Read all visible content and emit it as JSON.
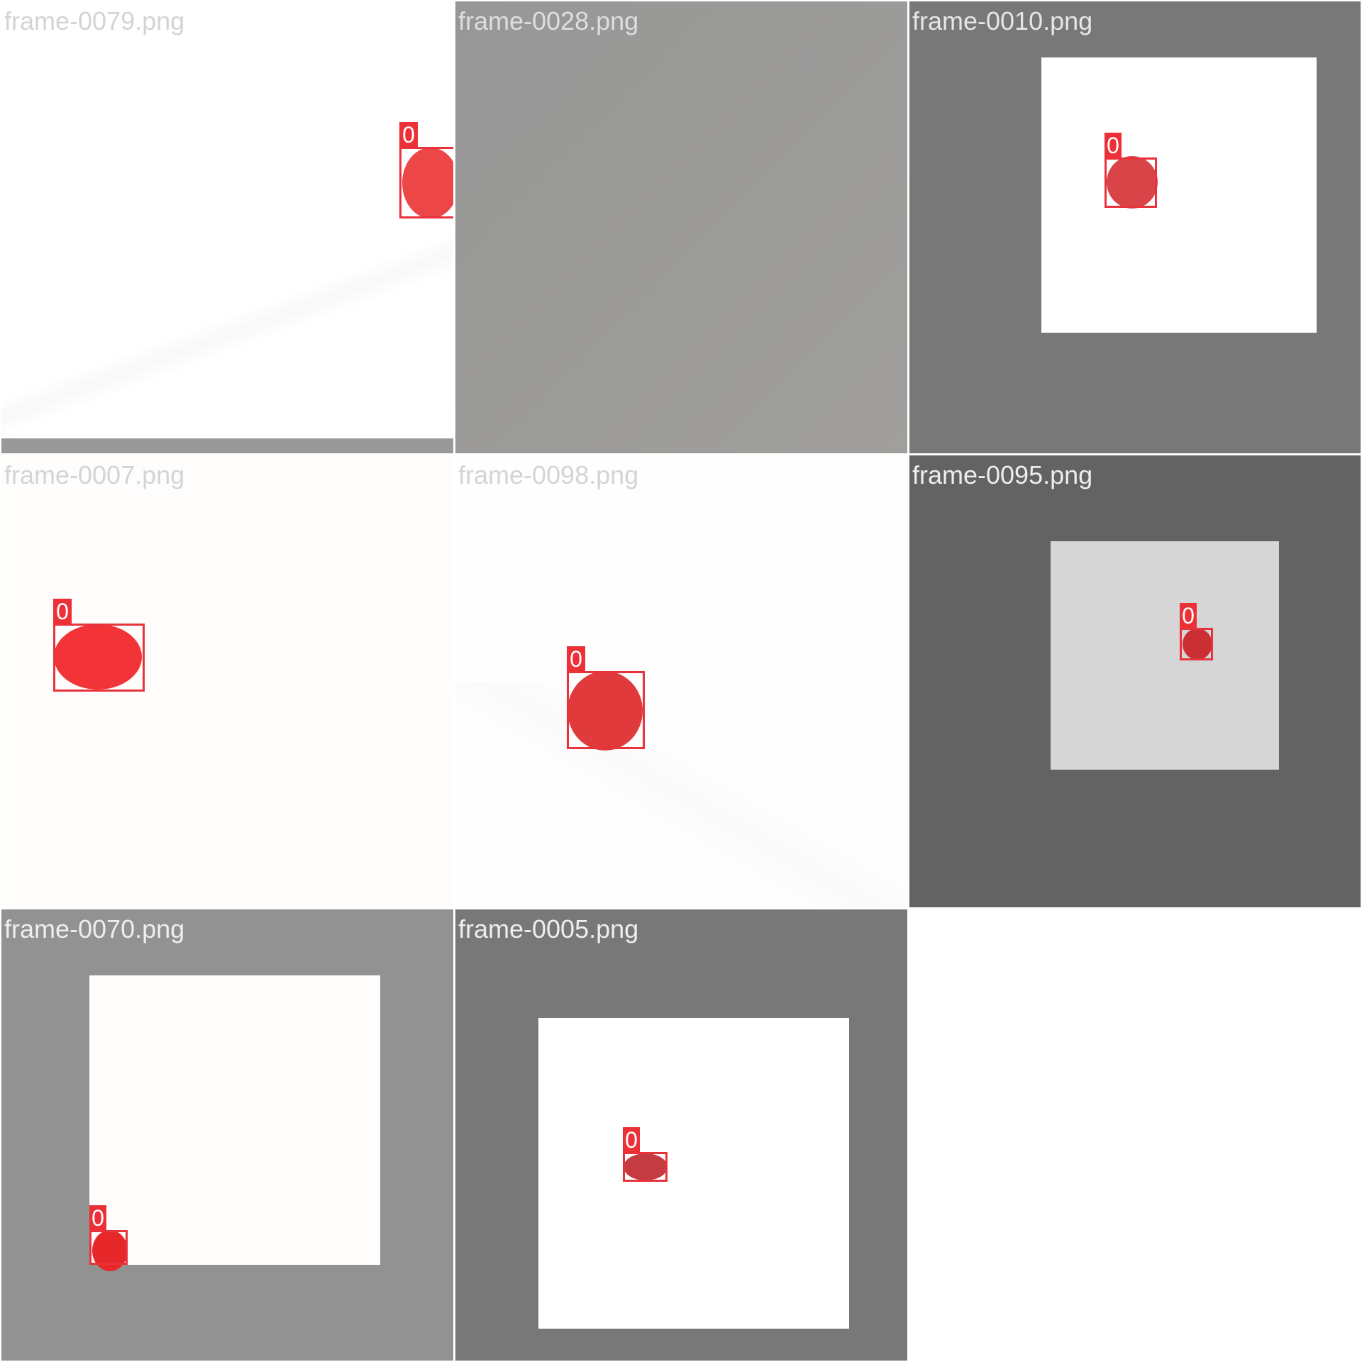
{
  "tiles": [
    {
      "filename": "frame-0079.png",
      "label": "0"
    },
    {
      "filename": "frame-0028.png"
    },
    {
      "filename": "frame-0010.png",
      "label": "0"
    },
    {
      "filename": "frame-0007.png",
      "label": "0"
    },
    {
      "filename": "frame-0098.png",
      "label": "0"
    },
    {
      "filename": "frame-0095.png",
      "label": "0"
    },
    {
      "filename": "frame-0070.png",
      "label": "0"
    },
    {
      "filename": "frame-0005.png",
      "label": "0"
    }
  ],
  "colors": {
    "box_outline": "#e8323c",
    "label_bg": "#ec3038",
    "label_text": "#ffffff"
  }
}
